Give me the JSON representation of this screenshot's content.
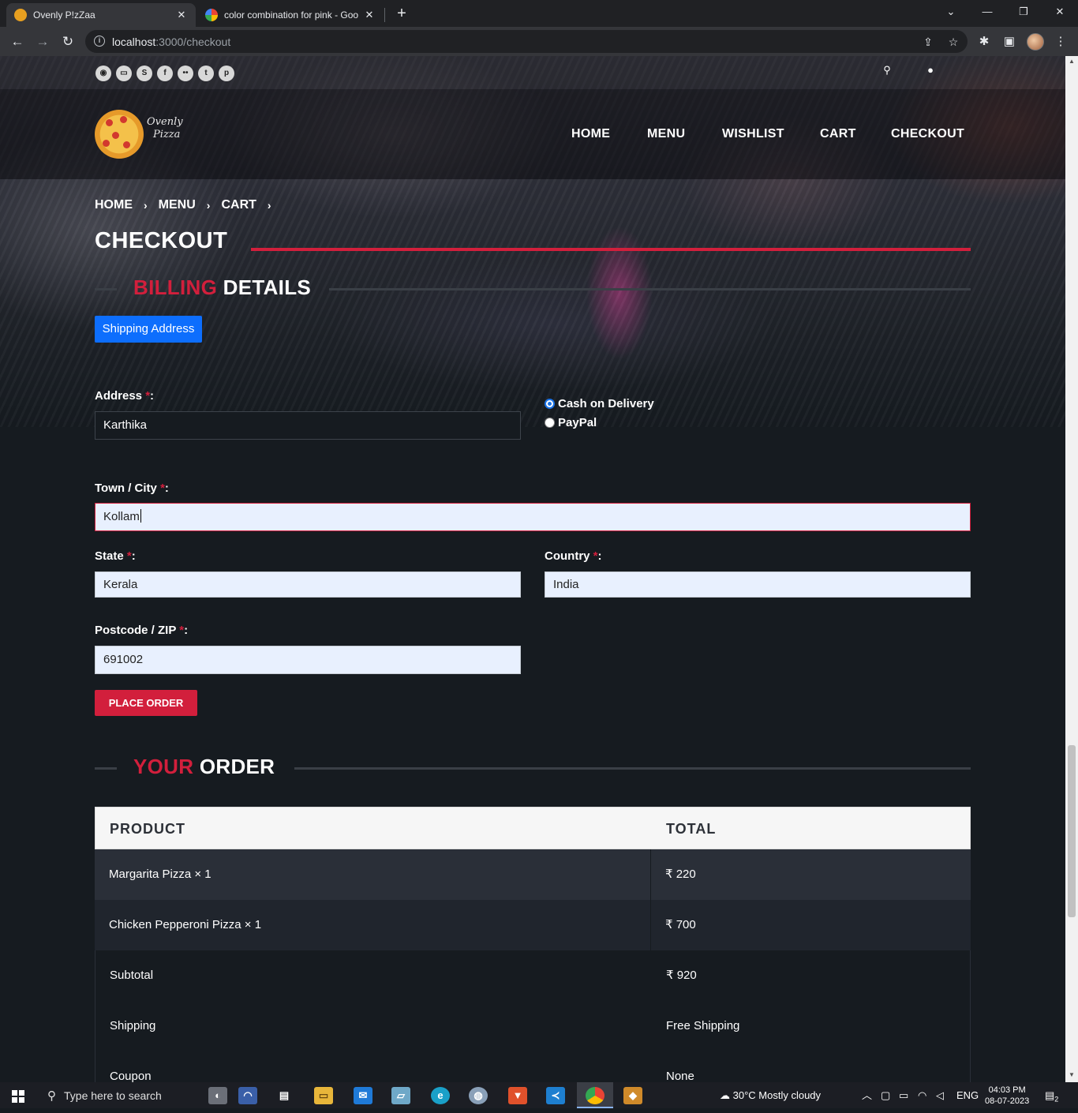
{
  "browser": {
    "tabs": [
      {
        "title": "Ovenly P!zZaa",
        "close": "✕",
        "favicon_color": "#e8a020"
      },
      {
        "title": "color combination for pink - Goo",
        "close": "✕",
        "favicon_color": "#4285f4"
      }
    ],
    "new_tab": "+",
    "window_controls": {
      "dropdown": "⌄",
      "minimize": "—",
      "restore": "❐",
      "close": "✕"
    },
    "url_host": "localhost",
    "url_rest": ":3000/checkout"
  },
  "site": {
    "social_icons": [
      "rss-icon",
      "chat-icon",
      "skype-icon",
      "facebook-icon",
      "flickr-icon",
      "twitter-icon",
      "pinterest-icon"
    ],
    "logo_text_1": "Ovenly",
    "logo_text_2": "Pizza",
    "nav": [
      "HOME",
      "MENU",
      "WISHLIST",
      "CART",
      "CHECKOUT"
    ],
    "breadcrumb": [
      "HOME",
      "MENU",
      "CART"
    ],
    "breadcrumb_sep": "›",
    "page_title": "CHECKOUT",
    "accent_color": "#d21f3c"
  },
  "billing": {
    "title_accent": "BILLING",
    "title_rest": " DETAILS",
    "shipping_button": "Shipping Address",
    "required_mark": "*",
    "address_label": "Address ",
    "address_value": "Karthika",
    "payment_options": [
      {
        "label": "Cash on Delivery",
        "selected": true
      },
      {
        "label": "PayPal",
        "selected": false
      }
    ],
    "city_label": "Town / City ",
    "city_value": "Kollam",
    "state_label": "State ",
    "state_value": "Kerala",
    "country_label": "Country ",
    "country_value": "India",
    "zip_label": "Postcode / ZIP ",
    "zip_value": "691002",
    "place_order": "PLACE ORDER"
  },
  "order": {
    "title_accent": "YOUR",
    "title_rest": " ORDER",
    "headers": [
      "PRODUCT",
      "TOTAL"
    ],
    "items": [
      {
        "product": "Margarita Pizza × 1",
        "total": "₹ 220"
      },
      {
        "product": "Chicken Pepperoni Pizza × 1",
        "total": "₹ 700"
      }
    ],
    "summary": [
      {
        "label": "Subtotal",
        "value": "₹ 920"
      },
      {
        "label": "Shipping",
        "value": "Free Shipping"
      },
      {
        "label": "Coupon",
        "value": "None"
      }
    ]
  },
  "taskbar": {
    "search_placeholder": "Type here to search",
    "weather": "30°C  Mostly cloudy",
    "language": "ENG",
    "time": "04:03 PM",
    "date": "08-07-2023",
    "notifications": "2"
  }
}
